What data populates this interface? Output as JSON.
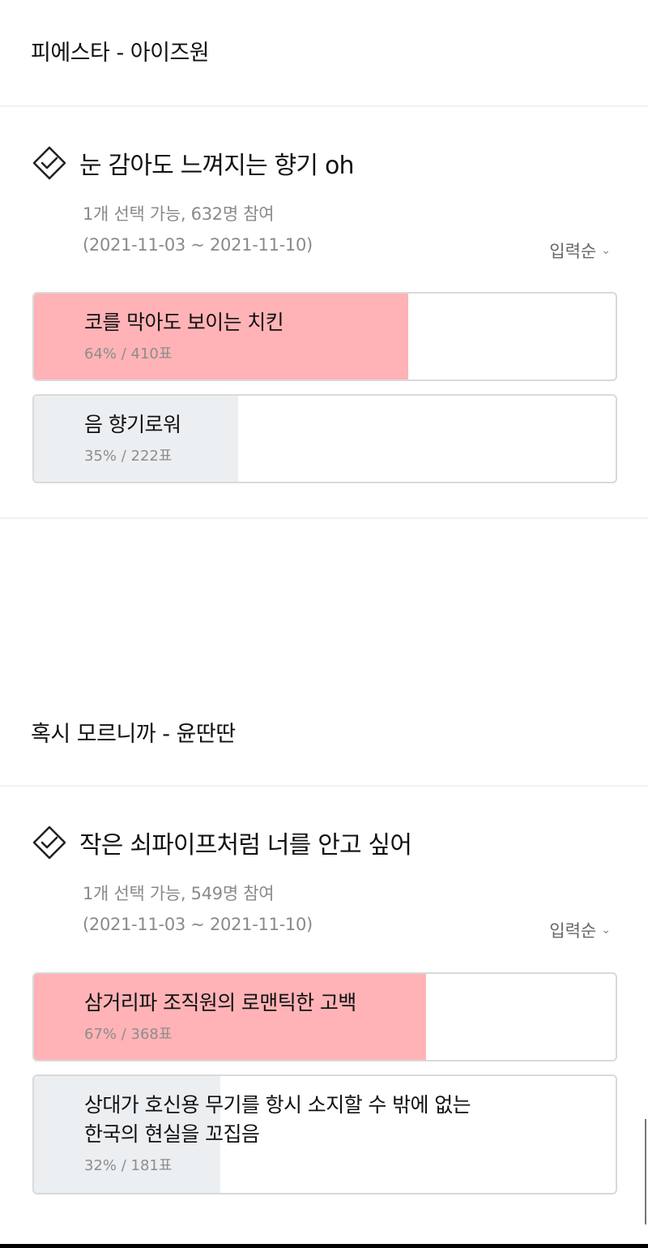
{
  "posts": [
    {
      "title": "피에스타 - 아이즈원",
      "poll": {
        "question": "눈 감아도 느껴지는 향기 oh",
        "meta": "1개 선택 가능, 632명 참여",
        "period": "(2021-11-03 ~ 2021-11-10)",
        "sort_label": "입력순",
        "options": [
          {
            "label": "코를 막아도 보이는 치킨",
            "stat": "64% / 410표",
            "percent": 64,
            "winner": true
          },
          {
            "label": "음 향기로워",
            "stat": "35% / 222표",
            "percent": 35,
            "winner": false
          }
        ]
      }
    },
    {
      "title": "혹시 모르니까 - 윤딴딴",
      "poll": {
        "question": "작은 쇠파이프처럼 너를 안고 싶어",
        "meta": "1개 선택 가능, 549명 참여",
        "period": "(2021-11-03 ~ 2021-11-10)",
        "sort_label": "입력순",
        "options": [
          {
            "label": "삼거리파 조직원의 로맨틱한 고백",
            "stat": "67% / 368표",
            "percent": 67,
            "winner": true
          },
          {
            "label": "상대가 호신용 무기를 항시 소지할 수 밖에 없는",
            "label2": "한국의 현실을 꼬집음",
            "stat": "32% / 181표",
            "percent": 32,
            "winner": false
          }
        ]
      }
    }
  ],
  "colors": {
    "winner_fill": "#ffb3b6",
    "loser_fill": "#eceff2",
    "border": "#d9d9d9"
  },
  "icons": {
    "poll_icon": "check-diamond-icon",
    "sort_icon": "chevron-down-icon"
  }
}
